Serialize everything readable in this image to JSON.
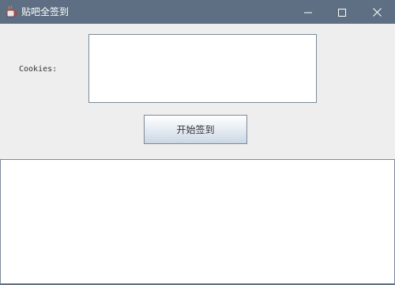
{
  "window": {
    "title": "贴吧全签到",
    "app_icon": "java-cup-icon",
    "controls": {
      "minimize_icon": "minimize-icon",
      "maximize_icon": "maximize-icon",
      "close_icon": "close-icon"
    }
  },
  "form": {
    "cookies_label": "Cookies:",
    "cookies_value": "",
    "start_button_label": "开始签到"
  },
  "output": {
    "log_text": ""
  },
  "colors": {
    "titlebar": "#5e6f83",
    "panel": "#eeeeee",
    "border": "#7a8a99"
  }
}
